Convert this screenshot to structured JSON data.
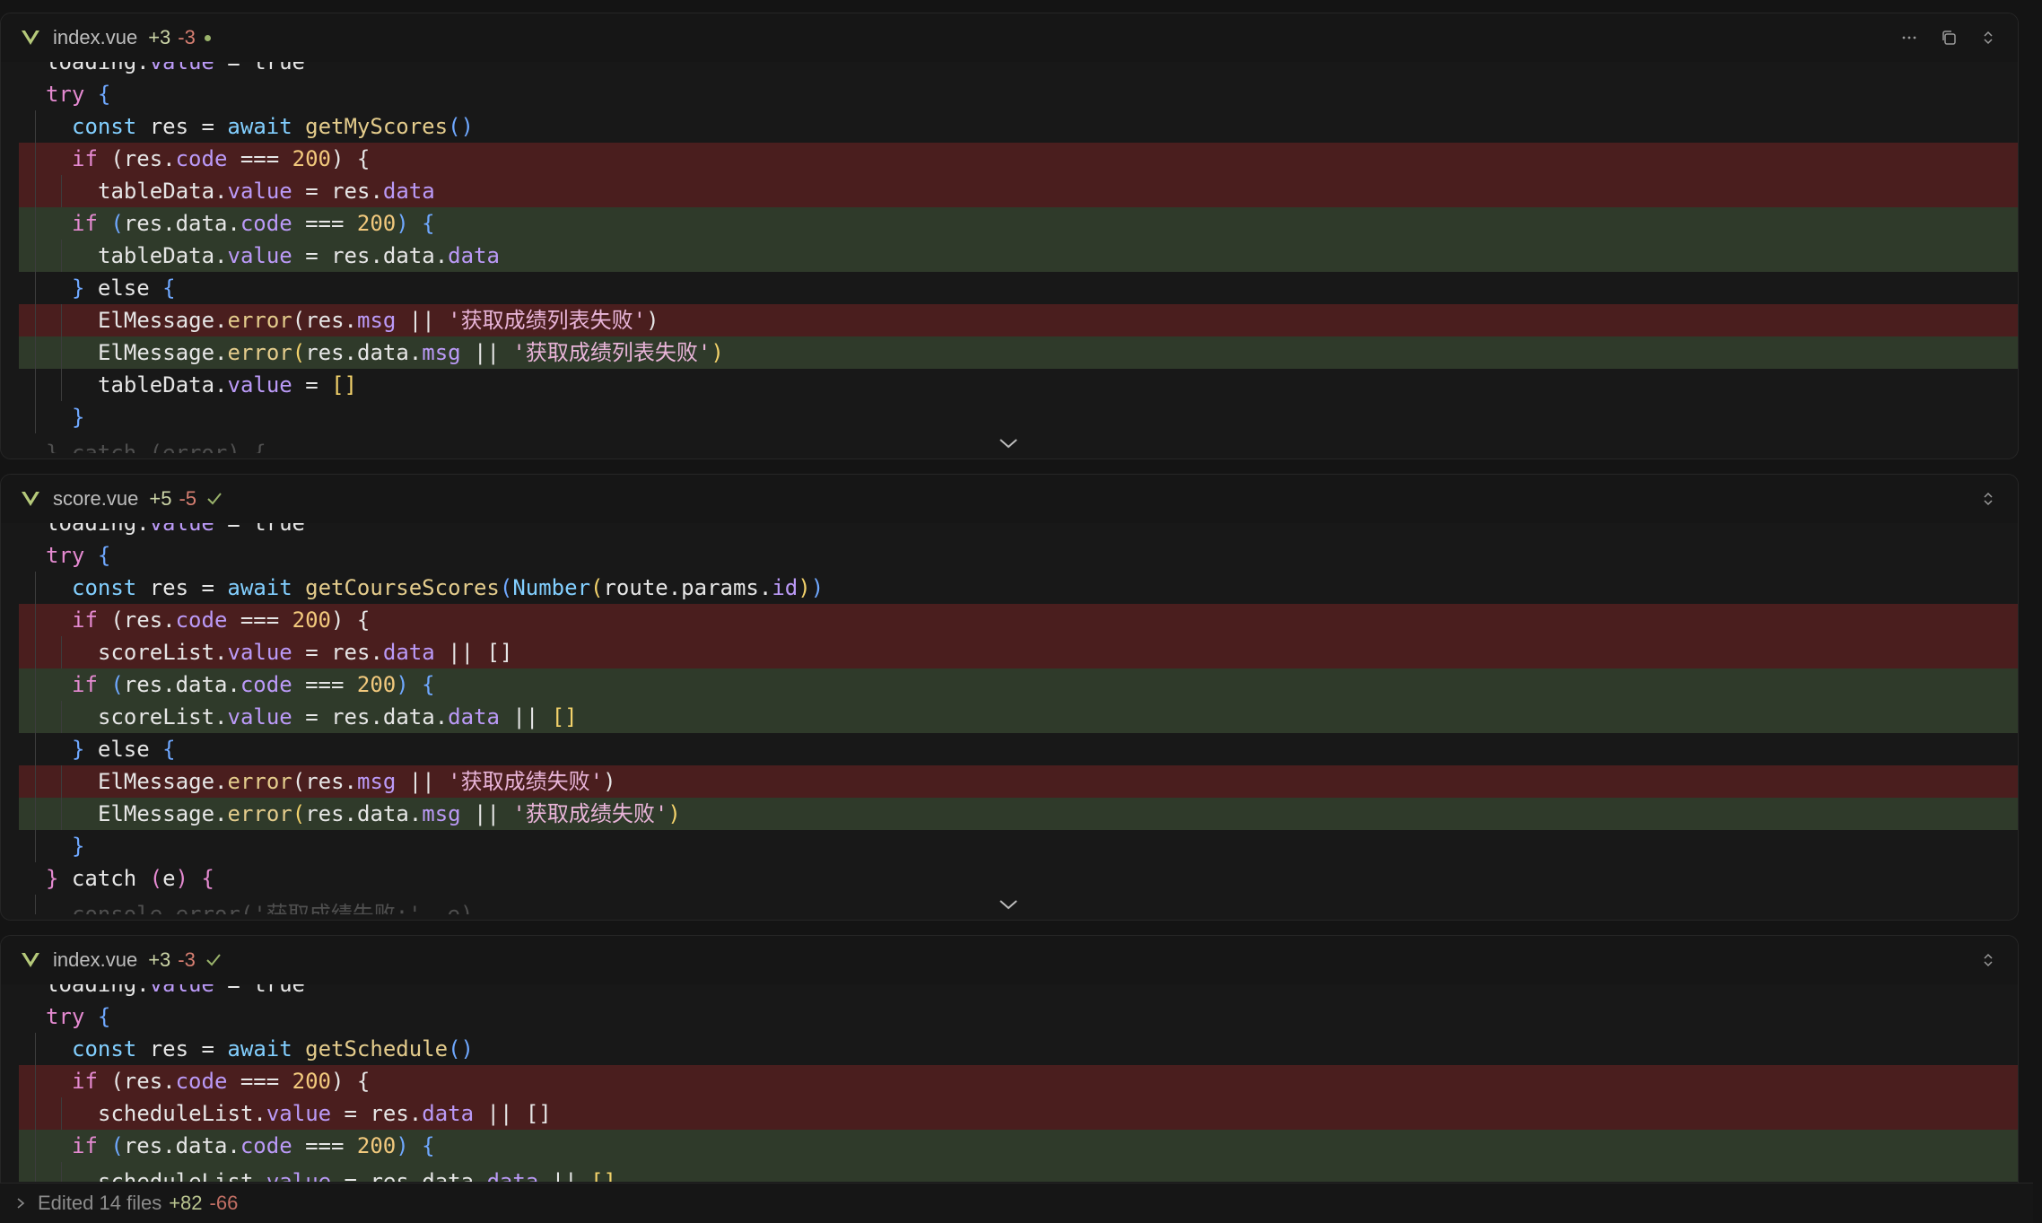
{
  "panels": [
    {
      "file_name": "index.vue",
      "additions": "+3",
      "deletions": "-3",
      "status": "modified-unsaved",
      "lines": [
        {
          "type": "clip-top",
          "indent": 0,
          "tokens": [
            [
              "v",
              "loading."
            ],
            [
              "p",
              "value"
            ],
            [
              "v",
              " = true"
            ]
          ]
        },
        {
          "type": "ctx",
          "indent": 0,
          "tokens": [
            [
              "k",
              "try"
            ],
            [
              "v",
              " "
            ],
            [
              "b",
              "{"
            ]
          ]
        },
        {
          "type": "ctx",
          "indent": 1,
          "tokens": [
            [
              "c",
              "const "
            ],
            [
              "v",
              "res"
            ],
            [
              "v",
              " = "
            ],
            [
              "c",
              "await "
            ],
            [
              "f",
              "getMyScores"
            ],
            [
              "b",
              "()"
            ]
          ]
        },
        {
          "type": "del",
          "indent": 1,
          "tokens": [
            [
              "k",
              "if"
            ],
            [
              "v",
              " (res."
            ],
            [
              "p",
              "code"
            ],
            [
              "v",
              " === "
            ],
            [
              "n",
              "200"
            ],
            [
              "v",
              ") {"
            ]
          ]
        },
        {
          "type": "del",
          "indent": 2,
          "tokens": [
            [
              "v",
              "tableData."
            ],
            [
              "p",
              "value"
            ],
            [
              "v",
              " = res."
            ],
            [
              "p",
              "data"
            ]
          ]
        },
        {
          "type": "add",
          "indent": 1,
          "tokens": [
            [
              "k",
              "if"
            ],
            [
              "b",
              " ("
            ],
            [
              "v",
              "res.data."
            ],
            [
              "p",
              "code"
            ],
            [
              "v",
              " === "
            ],
            [
              "n",
              "200"
            ],
            [
              "b",
              ")"
            ],
            [
              "v",
              " "
            ],
            [
              "b",
              "{"
            ]
          ]
        },
        {
          "type": "add",
          "indent": 2,
          "tokens": [
            [
              "v",
              "tableData."
            ],
            [
              "p",
              "value"
            ],
            [
              "v",
              " = res.data."
            ],
            [
              "p",
              "data"
            ]
          ]
        },
        {
          "type": "ctx",
          "indent": 1,
          "tokens": [
            [
              "b",
              "}"
            ],
            [
              "v",
              " else "
            ],
            [
              "b",
              "{"
            ]
          ]
        },
        {
          "type": "del",
          "indent": 2,
          "tokens": [
            [
              "v",
              "ElMessage."
            ],
            [
              "f",
              "error"
            ],
            [
              "v",
              "(res."
            ],
            [
              "p",
              "msg"
            ],
            [
              "v",
              " || "
            ],
            [
              "s",
              "'获取成绩列表失败'"
            ],
            [
              "v",
              ")"
            ]
          ]
        },
        {
          "type": "add",
          "indent": 2,
          "tokens": [
            [
              "v",
              "ElMessage."
            ],
            [
              "f",
              "error"
            ],
            [
              "y",
              "("
            ],
            [
              "v",
              "res.data."
            ],
            [
              "p",
              "msg"
            ],
            [
              "v",
              " || "
            ],
            [
              "s",
              "'获取成绩列表失败'"
            ],
            [
              "y",
              ")"
            ]
          ]
        },
        {
          "type": "ctx",
          "indent": 2,
          "tokens": [
            [
              "v",
              "tableData."
            ],
            [
              "p",
              "value"
            ],
            [
              "v",
              " = "
            ],
            [
              "y",
              "[]"
            ]
          ]
        },
        {
          "type": "ctx",
          "indent": 1,
          "tokens": [
            [
              "b",
              "}"
            ]
          ]
        },
        {
          "type": "clip-bottom",
          "indent": 0,
          "tokens": [
            [
              "v",
              "} catch (error) {"
            ]
          ]
        }
      ]
    },
    {
      "file_name": "score.vue",
      "additions": "+5",
      "deletions": "-5",
      "status": "saved",
      "lines": [
        {
          "type": "clip-top",
          "indent": 0,
          "tokens": [
            [
              "v",
              "loading."
            ],
            [
              "p",
              "value"
            ],
            [
              "v",
              " = true"
            ]
          ]
        },
        {
          "type": "ctx",
          "indent": 0,
          "tokens": [
            [
              "k",
              "try"
            ],
            [
              "v",
              " "
            ],
            [
              "b",
              "{"
            ]
          ]
        },
        {
          "type": "ctx",
          "indent": 1,
          "tokens": [
            [
              "c",
              "const "
            ],
            [
              "v",
              "res"
            ],
            [
              "v",
              " = "
            ],
            [
              "c",
              "await "
            ],
            [
              "f",
              "getCourseScores"
            ],
            [
              "b",
              "("
            ],
            [
              "c",
              "Number"
            ],
            [
              "y",
              "("
            ],
            [
              "v",
              "route.params."
            ],
            [
              "p",
              "id"
            ],
            [
              "y",
              ")"
            ],
            [
              "b",
              ")"
            ]
          ]
        },
        {
          "type": "del",
          "indent": 1,
          "tokens": [
            [
              "k",
              "if"
            ],
            [
              "v",
              " (res."
            ],
            [
              "p",
              "code"
            ],
            [
              "v",
              " === "
            ],
            [
              "n",
              "200"
            ],
            [
              "v",
              ") {"
            ]
          ]
        },
        {
          "type": "del",
          "indent": 2,
          "tokens": [
            [
              "v",
              "scoreList."
            ],
            [
              "p",
              "value"
            ],
            [
              "v",
              " = res."
            ],
            [
              "p",
              "data"
            ],
            [
              "v",
              " || []"
            ]
          ]
        },
        {
          "type": "add",
          "indent": 1,
          "tokens": [
            [
              "k",
              "if"
            ],
            [
              "b",
              " ("
            ],
            [
              "v",
              "res.data."
            ],
            [
              "p",
              "code"
            ],
            [
              "v",
              " === "
            ],
            [
              "n",
              "200"
            ],
            [
              "b",
              ")"
            ],
            [
              "v",
              " "
            ],
            [
              "b",
              "{"
            ]
          ]
        },
        {
          "type": "add",
          "indent": 2,
          "tokens": [
            [
              "v",
              "scoreList."
            ],
            [
              "p",
              "value"
            ],
            [
              "v",
              " = res.data."
            ],
            [
              "p",
              "data"
            ],
            [
              "v",
              " || "
            ],
            [
              "y",
              "[]"
            ]
          ]
        },
        {
          "type": "ctx",
          "indent": 1,
          "tokens": [
            [
              "b",
              "}"
            ],
            [
              "v",
              " else "
            ],
            [
              "b",
              "{"
            ]
          ]
        },
        {
          "type": "del",
          "indent": 2,
          "tokens": [
            [
              "v",
              "ElMessage."
            ],
            [
              "f",
              "error"
            ],
            [
              "v",
              "(res."
            ],
            [
              "p",
              "msg"
            ],
            [
              "v",
              " || "
            ],
            [
              "s",
              "'获取成绩失败'"
            ],
            [
              "v",
              ")"
            ]
          ]
        },
        {
          "type": "add",
          "indent": 2,
          "tokens": [
            [
              "v",
              "ElMessage."
            ],
            [
              "f",
              "error"
            ],
            [
              "y",
              "("
            ],
            [
              "v",
              "res.data."
            ],
            [
              "p",
              "msg"
            ],
            [
              "v",
              " || "
            ],
            [
              "s",
              "'获取成绩失败'"
            ],
            [
              "y",
              ")"
            ]
          ]
        },
        {
          "type": "ctx",
          "indent": 1,
          "tokens": [
            [
              "b",
              "}"
            ]
          ]
        },
        {
          "type": "ctx",
          "indent": 0,
          "tokens": [
            [
              "k",
              "}"
            ],
            [
              "v",
              " catch "
            ],
            [
              "k",
              "("
            ],
            [
              "v",
              "e"
            ],
            [
              "k",
              ")"
            ],
            [
              "v",
              " "
            ],
            [
              "k",
              "{"
            ]
          ]
        },
        {
          "type": "clip-bottom",
          "indent": 1,
          "tokens": [
            [
              "v",
              "console.error('获取成绩失败:', e)"
            ]
          ]
        }
      ]
    },
    {
      "file_name": "index.vue",
      "additions": "+3",
      "deletions": "-3",
      "status": "saved",
      "lines": [
        {
          "type": "clip-top",
          "indent": 0,
          "tokens": [
            [
              "v",
              "loading."
            ],
            [
              "p",
              "value"
            ],
            [
              "v",
              " = true"
            ]
          ]
        },
        {
          "type": "ctx",
          "indent": 0,
          "tokens": [
            [
              "k",
              "try"
            ],
            [
              "v",
              " "
            ],
            [
              "b",
              "{"
            ]
          ]
        },
        {
          "type": "ctx",
          "indent": 1,
          "tokens": [
            [
              "c",
              "const "
            ],
            [
              "v",
              "res"
            ],
            [
              "v",
              " = "
            ],
            [
              "c",
              "await "
            ],
            [
              "f",
              "getSchedule"
            ],
            [
              "b",
              "()"
            ]
          ]
        },
        {
          "type": "del",
          "indent": 1,
          "tokens": [
            [
              "k",
              "if"
            ],
            [
              "v",
              " (res."
            ],
            [
              "p",
              "code"
            ],
            [
              "v",
              " === "
            ],
            [
              "n",
              "200"
            ],
            [
              "v",
              ") {"
            ]
          ]
        },
        {
          "type": "del",
          "indent": 2,
          "tokens": [
            [
              "v",
              "scheduleList."
            ],
            [
              "p",
              "value"
            ],
            [
              "v",
              " = res."
            ],
            [
              "p",
              "data"
            ],
            [
              "v",
              " || []"
            ]
          ]
        },
        {
          "type": "add",
          "indent": 1,
          "tokens": [
            [
              "k",
              "if"
            ],
            [
              "b",
              " ("
            ],
            [
              "v",
              "res.data."
            ],
            [
              "p",
              "code"
            ],
            [
              "v",
              " === "
            ],
            [
              "n",
              "200"
            ],
            [
              "b",
              ")"
            ],
            [
              "v",
              " "
            ],
            [
              "b",
              "{"
            ]
          ]
        },
        {
          "type": "add-clip",
          "indent": 2,
          "tokens": [
            [
              "v",
              "scheduleList."
            ],
            [
              "p",
              "value"
            ],
            [
              "v",
              " = res.data."
            ],
            [
              "p",
              "data"
            ],
            [
              "v",
              " || "
            ],
            [
              "y",
              "[]"
            ]
          ]
        }
      ]
    }
  ],
  "footer": {
    "label": "Edited 14 files",
    "additions": "+82",
    "deletions": "-66"
  },
  "colors": {
    "deleted_line_bg": "#4a1e1e",
    "added_line_bg": "#2f3a2a",
    "vue_icon": "#b5c97a"
  }
}
